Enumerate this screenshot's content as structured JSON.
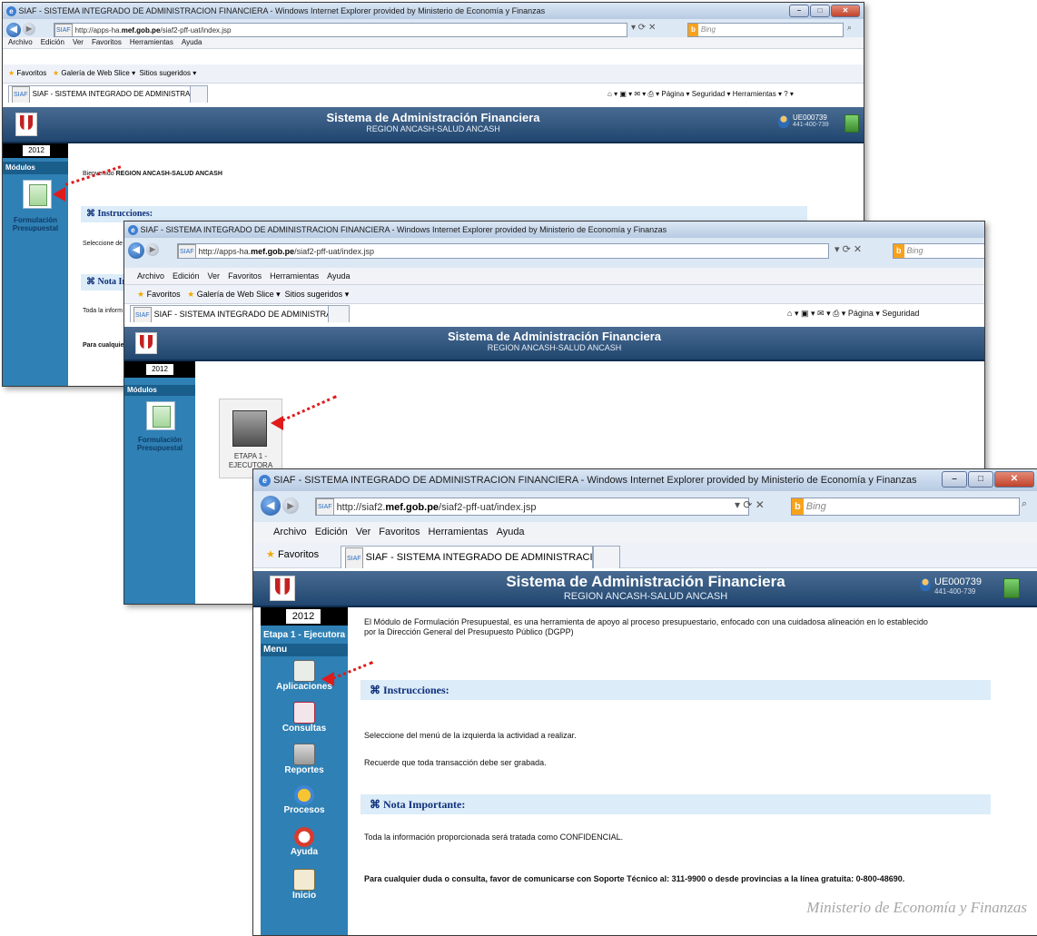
{
  "browser": {
    "title": "SIAF - SISTEMA INTEGRADO DE ADMINISTRACION FINANCIERA - Windows Internet Explorer provided by Ministerio de Economía y Finanzas",
    "url_prefix_1": "http://apps-ha.",
    "url_bold_1": "mef.gob.pe",
    "url_suffix_1": "/siaf2-pff-uat/index.jsp",
    "url_prefix_3": "http://siaf2.",
    "url_bold_3": "mef.gob.pe",
    "url_suffix_3": "/siaf2-pff-uat/index.jsp",
    "search_placeholder": "Bing",
    "menu": {
      "archivo": "Archivo",
      "edicion": "Edición",
      "ver": "Ver",
      "favoritos": "Favoritos",
      "herramientas": "Herramientas",
      "ayuda": "Ayuda"
    },
    "favorites_label": "Favoritos",
    "web_slice": "Galería de Web Slice",
    "sugeridos": "Sitios sugeridos",
    "tab_label": "SIAF - SISTEMA INTEGRADO DE ADMINISTRACIO...",
    "cmd_pagina": "Página",
    "cmd_seguridad": "Seguridad",
    "cmd_herramientas": "Herramientas"
  },
  "app": {
    "title": "Sistema de Administración Financiera",
    "subtitle": "REGION ANCASH-SALUD ANCASH",
    "user_id": "UE000739",
    "user_phone": "441-400-739",
    "year": "2012"
  },
  "screen1": {
    "modules_label": "Módulos",
    "module_name": "Formulación Presupuestal",
    "welcome_prefix": "Bienvenido ",
    "welcome_name": "REGION ANCASH-SALUD ANCASH",
    "instructions_title": "Instrucciones:",
    "select_prefix": "Seleccione de",
    "nota_title": "Nota Im",
    "toda_prefix": "Toda la inform",
    "para_prefix": "Para cualquie"
  },
  "screen2": {
    "modules_label": "Módulos",
    "module_name": "Formulación Presupuestal",
    "etapa_line1": "ETAPA 1 -",
    "etapa_line2": "EJECUTORA"
  },
  "screen3": {
    "etapa_label": "Etapa 1 - Ejecutora",
    "menu_label": "Menu",
    "menu_items": [
      "Aplicaciones",
      "Consultas",
      "Reportes",
      "Procesos",
      "Ayuda",
      "Inicio"
    ],
    "intro": "El Módulo de Formulación Presupuestal, es una herramienta de apoyo al proceso presupuestario, enfocado con una cuidadosa alineación en lo establecido",
    "intro2": "por la Dirección General del Presupuesto Público (DGPP)",
    "instructions_title": "Instrucciones:",
    "instr_line1": "Seleccione del menú de la izquierda la actividad a realizar.",
    "instr_line2": "Recuerde que toda transacción debe ser grabada.",
    "nota_title": "Nota Importante:",
    "nota_line1": "Toda la información proporcionada será tratada como CONFIDENCIAL.",
    "nota_line2": "Para cualquier duda o consulta, favor de comunicarse con Soporte Técnico al: 311-9900 o desde provincias a la línea gratuita: 0-800-48690."
  },
  "watermark": "Ministerio de Economía y Finanzas",
  "colors": {
    "header": "#20466f",
    "sidebar": "#2f80b4",
    "section": "#dcecf8",
    "arrow": "#e01b1b"
  }
}
